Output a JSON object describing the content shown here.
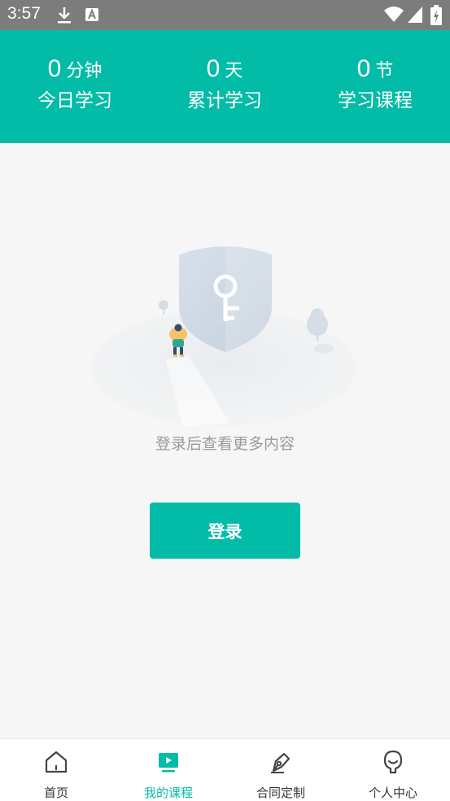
{
  "status_bar": {
    "time": "3:57"
  },
  "stats": [
    {
      "value": "0",
      "unit": "分钟",
      "label": "今日学习"
    },
    {
      "value": "0",
      "unit": "天",
      "label": "累计学习"
    },
    {
      "value": "0",
      "unit": "节",
      "label": "学习课程"
    }
  ],
  "empty_state": {
    "message": "登录后查看更多内容"
  },
  "login_button": {
    "label": "登录"
  },
  "bottom_nav": {
    "items": [
      {
        "label": "首页",
        "icon": "home-icon",
        "active": false
      },
      {
        "label": "我的课程",
        "icon": "play-screen-icon",
        "active": true
      },
      {
        "label": "合同定制",
        "icon": "pen-icon",
        "active": false
      },
      {
        "label": "个人中心",
        "icon": "person-icon",
        "active": false
      }
    ]
  },
  "colors": {
    "accent": "#02bca7",
    "status_bar": "#7c7c7c",
    "background": "#f6f6f6"
  }
}
